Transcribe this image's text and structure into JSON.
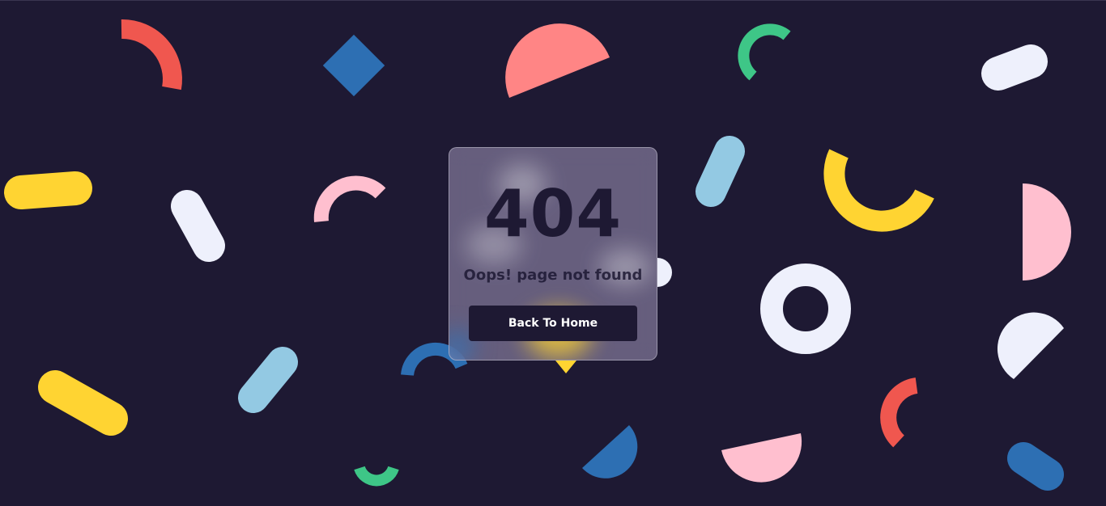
{
  "error": {
    "code": "404",
    "message": "Oops! page not found",
    "button_label": "Back To Home"
  },
  "colors": {
    "background": "#1e1933",
    "red": "#f0574f",
    "salmon": "#ff8585",
    "blue": "#2d6fb3",
    "green": "#3ec687",
    "yellow": "#ffd432",
    "light_blue": "#93c9e3",
    "white": "#eef0fc",
    "pink": "#ffbfcf"
  }
}
